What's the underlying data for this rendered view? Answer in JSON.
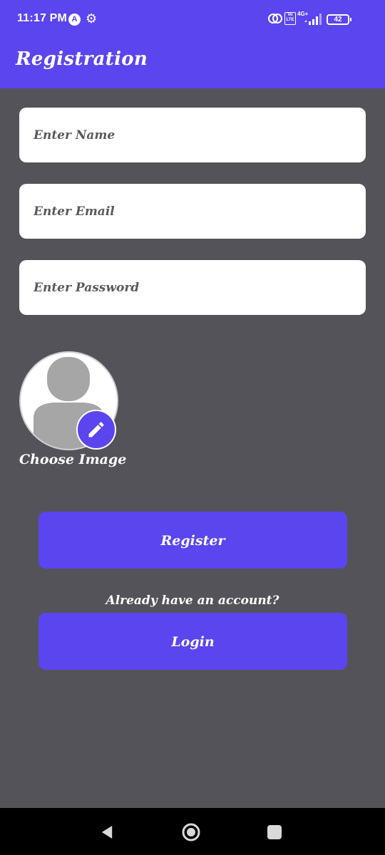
{
  "status_bar": {
    "time": "11:17 PM",
    "app_icon": "A",
    "network_label": "4G+",
    "volte_label": "Vo LTE",
    "battery": "42"
  },
  "app_bar": {
    "title": "Registration"
  },
  "form": {
    "name_placeholder": "Enter Name",
    "email_placeholder": "Enter Email",
    "password_placeholder": "Enter Password",
    "choose_image_label": "Choose Image",
    "register_label": "Register",
    "account_prompt": "Already have an account?",
    "login_label": "Login"
  },
  "colors": {
    "primary": "#5b45ef",
    "background": "#545359",
    "input_background": "#ffffff"
  },
  "icons": {
    "gear": "gear-icon",
    "edit": "pencil-icon",
    "avatar": "person-icon",
    "nav_back": "back-triangle-icon",
    "nav_home": "home-circle-icon",
    "nav_recents": "recents-square-icon"
  }
}
